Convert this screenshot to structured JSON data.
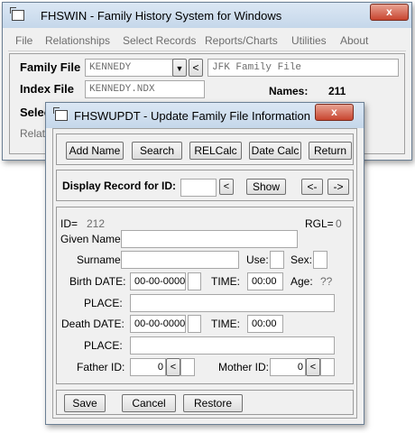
{
  "main_window": {
    "title": "FHSWIN - Family History System  for  Windows",
    "close_label": "x",
    "menu": [
      "File",
      "Relationships",
      "Select Records",
      "Reports/Charts",
      "Utilities",
      "About"
    ],
    "family_file_label": "Family File",
    "family_file_value": "KENNEDY",
    "family_file_desc": "JFK Family File",
    "index_file_label": "Index File",
    "index_file_value": "KENNEDY.NDX",
    "names_label": "Names:",
    "names_value": "211",
    "partial_label_1": "Selec",
    "partial_label_2": "Relat"
  },
  "dialog": {
    "title": "FHSWUPDT - Update Family File Information",
    "close_label": "x",
    "toolbar": [
      "Add Name",
      "Search",
      "RELCalc",
      "Date Calc",
      "Return"
    ],
    "display_label": "Display Record for ID:",
    "display_value": "",
    "prev_label": "<",
    "show_label": "Show",
    "nav_prev": "<-",
    "nav_next": "->",
    "id_label": "ID=",
    "id_value": "212",
    "rgl_label": "RGL=",
    "rgl_value": "0",
    "given_name_label": "Given Name:",
    "given_name_value": "",
    "surname_label": "Surname:",
    "surname_value": "",
    "use_label": "Use:",
    "sex_label": "Sex:",
    "birth_date_label": "Birth DATE:",
    "birth_date_value": "00-00-0000",
    "birth_time_label": "TIME:",
    "birth_time_value": "00:00",
    "age_label": "Age:",
    "age_value": "??",
    "place_label": "PLACE:",
    "birth_place_value": "",
    "death_date_label": "Death DATE:",
    "death_date_value": "00-00-0000",
    "death_time_label": "TIME:",
    "death_time_value": "00:00",
    "death_place_value": "",
    "father_label": "Father ID:",
    "father_value": "0",
    "mother_label": "Mother ID:",
    "mother_value": "0",
    "stepper_label": "<",
    "save_label": "Save",
    "cancel_label": "Cancel",
    "restore_label": "Restore"
  }
}
